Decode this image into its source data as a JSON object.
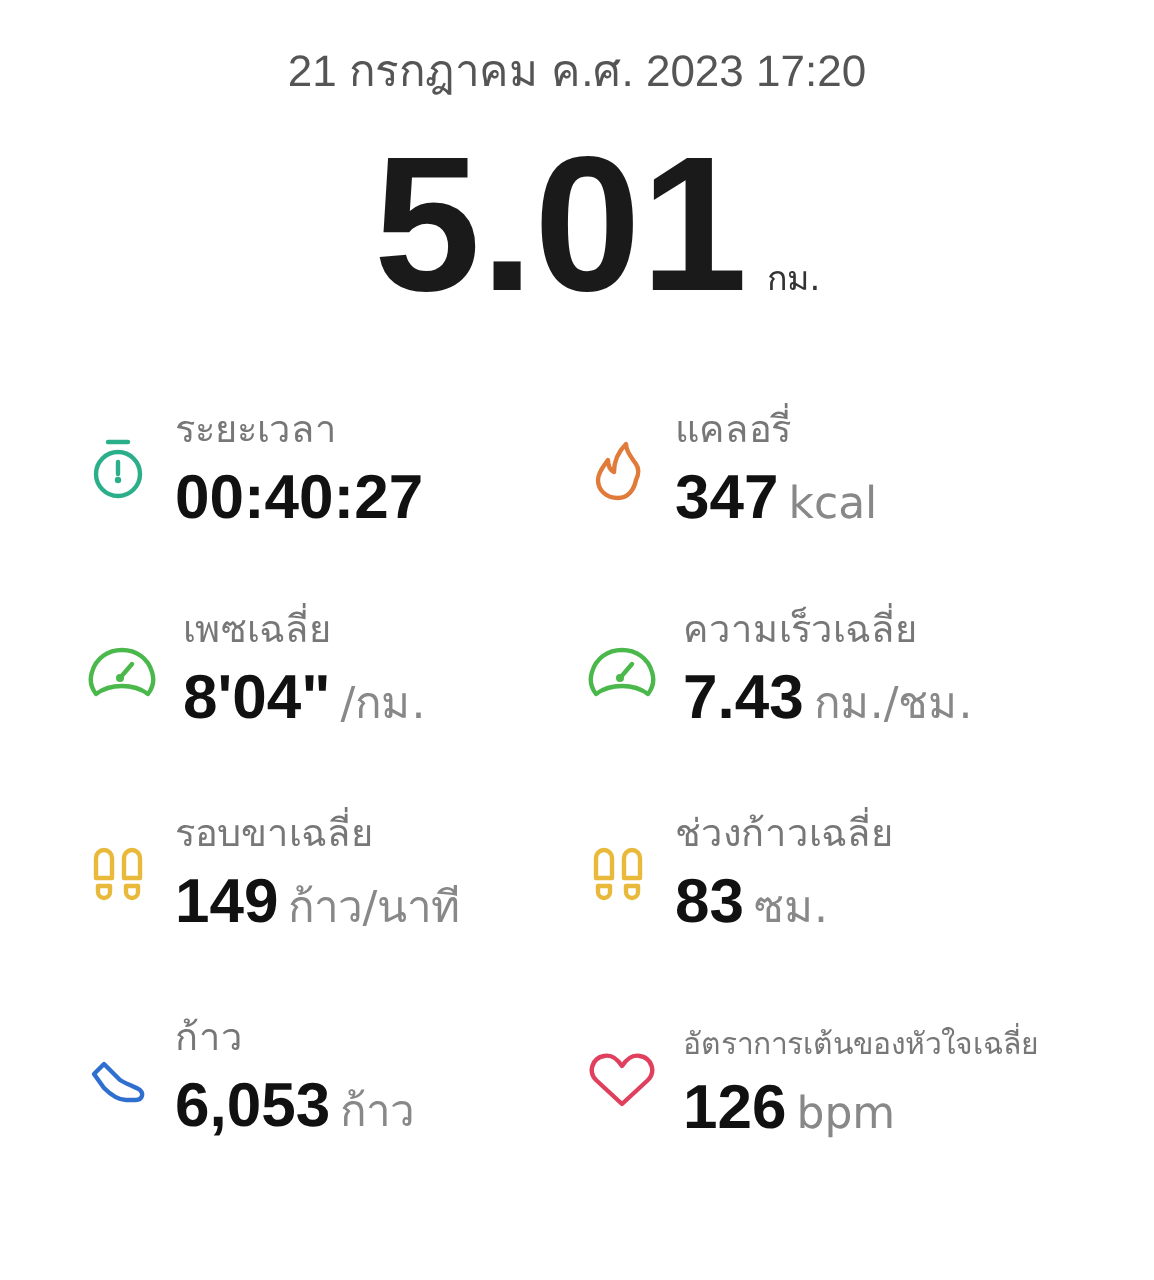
{
  "date": "21 กรกฎาคม ค.ศ. 2023 17:20",
  "distance": {
    "value": "5.01",
    "unit": "กม."
  },
  "stats": [
    {
      "kind": "stopwatch",
      "label": "ระยะเวลา",
      "value": "00:40:27"
    },
    {
      "kind": "flame",
      "label": "แคลอรี่",
      "value": "347",
      "unit": "kcal"
    },
    {
      "kind": "gauge",
      "label": "เพซเฉลี่ย",
      "value": "8'04\"",
      "unit": "/กม."
    },
    {
      "kind": "gauge",
      "label": "ความเร็วเฉลี่ย",
      "value": "7.43",
      "unit": "กม./ชม."
    },
    {
      "kind": "footprints",
      "label": "รอบขาเฉลี่ย",
      "value": "149",
      "unit": "ก้าว/นาที"
    },
    {
      "kind": "footprints",
      "label": "ช่วงก้าวเฉลี่ย",
      "value": "83",
      "unit": "ซม."
    },
    {
      "kind": "shoe",
      "label": "ก้าว",
      "value": "6,053",
      "unit": "ก้าว"
    },
    {
      "kind": "heart",
      "label": "อัตราการเต้นของหัวใจเฉลี่ย",
      "value": "126",
      "unit": "bpm"
    }
  ]
}
